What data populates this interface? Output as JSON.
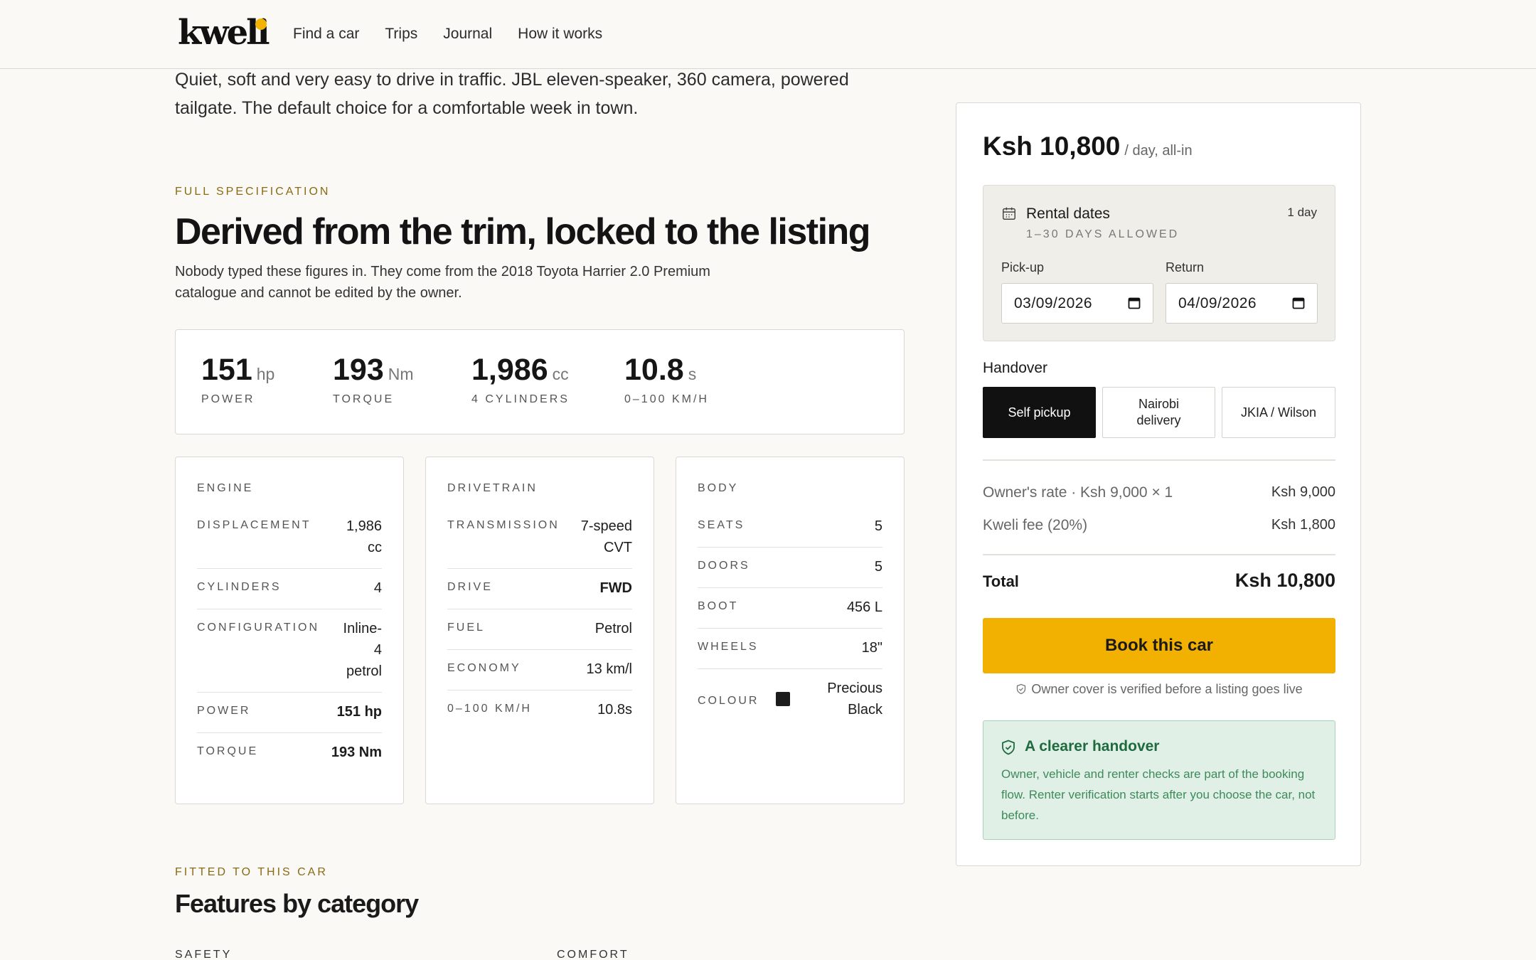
{
  "brand": {
    "name": "kweli",
    "accent": "#f2b400"
  },
  "nav": {
    "items": [
      "Find a car",
      "Trips",
      "Journal",
      "How it works"
    ]
  },
  "intro": "Quiet, soft and very easy to drive in traffic. JBL eleven-speaker, 360 camera, powered tailgate. The default choice for a comfortable week in town.",
  "spec": {
    "eyebrow": "FULL SPECIFICATION",
    "title": "Derived from the trim, locked to the listing",
    "subtitle": "Nobody typed these figures in. They come from the 2018 Toyota Harrier 2.0 Premium catalogue and cannot be edited by the owner.",
    "stats": [
      {
        "value": "151",
        "unit": "hp",
        "label": "POWER"
      },
      {
        "value": "193",
        "unit": "Nm",
        "label": "TORQUE"
      },
      {
        "value": "1,986",
        "unit": "cc",
        "label": "4 CYLINDERS"
      },
      {
        "value": "10.8",
        "unit": "s",
        "label": "0–100 KM/H"
      }
    ],
    "engine": {
      "title": "ENGINE",
      "rows": [
        {
          "k": "DISPLACEMENT",
          "v": "1,986\ncc"
        },
        {
          "k": "CYLINDERS",
          "v": "4"
        },
        {
          "k": "CONFIGURATION",
          "v": "Inline-\n4\npetrol"
        },
        {
          "k": "POWER",
          "v": "151 hp"
        },
        {
          "k": "TORQUE",
          "v": "193 Nm"
        }
      ]
    },
    "drivetrain": {
      "title": "DRIVETRAIN",
      "rows": [
        {
          "k": "TRANSMISSION",
          "v": "7-speed\nCVT"
        },
        {
          "k": "DRIVE",
          "v": "FWD"
        },
        {
          "k": "FUEL",
          "v": "Petrol"
        },
        {
          "k": "ECONOMY",
          "v": "13 km/l"
        },
        {
          "k": "0–100 KM/H",
          "v": "10.8s"
        }
      ]
    },
    "body": {
      "title": "BODY",
      "rows": [
        {
          "k": "SEATS",
          "v": "5"
        },
        {
          "k": "DOORS",
          "v": "5"
        },
        {
          "k": "BOOT",
          "v": "456 L"
        },
        {
          "k": "WHEELS",
          "v": "18\""
        },
        {
          "k": "COLOUR",
          "v": "Precious\nBlack",
          "swatch": "#1c1c1c"
        }
      ]
    }
  },
  "booking": {
    "price": "Ksh 10,800",
    "price_suffix": "/ day, all-in",
    "dates_title": "Rental dates",
    "dates_note": "1–30 DAYS ALLOWED",
    "dates_count": "1 day",
    "pickup_label": "Pick-up",
    "pickup_value": "03/09/2026",
    "return_label": "Return",
    "return_value": "04/09/2026",
    "handover_label": "Handover",
    "handover_options": [
      "Self pickup",
      "Nairobi delivery",
      "JKIA / Wilson"
    ],
    "handover_selected": "Self pickup",
    "owner_rate_label": "Owner's rate · Ksh 9,000 × 1",
    "owner_rate_value": "Ksh 9,000",
    "fee_label": "Kweli fee (20%)",
    "fee_value": "Ksh 1,800",
    "total_label": "Total",
    "total_value": "Ksh 10,800",
    "cta": "Book this car",
    "cover_note": "Owner cover is verified before a listing goes live",
    "notice_title": "A clearer handover",
    "notice_body": "Owner, vehicle and renter checks are part of the booking flow. Renter verification starts after you choose the car, not before."
  },
  "features": {
    "eyebrow": "FITTED TO THIS CAR",
    "title": "Features by category",
    "categories": [
      "SAFETY",
      "COMFORT"
    ]
  }
}
